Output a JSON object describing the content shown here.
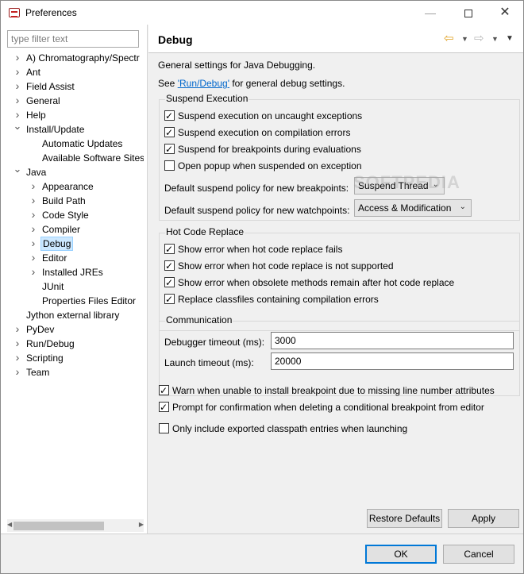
{
  "window": {
    "title": "Preferences",
    "minimize_glyph": "—",
    "close_glyph": "✕"
  },
  "filter": {
    "placeholder": "type filter text"
  },
  "tree": [
    {
      "label": "A) Chromatography/Spectr",
      "level": 0,
      "expanded": false,
      "has_children": true
    },
    {
      "label": "Ant",
      "level": 0,
      "expanded": false,
      "has_children": true
    },
    {
      "label": "Field Assist",
      "level": 0,
      "expanded": false,
      "has_children": true
    },
    {
      "label": "General",
      "level": 0,
      "expanded": false,
      "has_children": true
    },
    {
      "label": "Help",
      "level": 0,
      "expanded": false,
      "has_children": true
    },
    {
      "label": "Install/Update",
      "level": 0,
      "expanded": true,
      "has_children": true
    },
    {
      "label": "Automatic Updates",
      "level": 1,
      "expanded": false,
      "has_children": false
    },
    {
      "label": "Available Software Sites",
      "level": 1,
      "expanded": false,
      "has_children": false
    },
    {
      "label": "Java",
      "level": 0,
      "expanded": true,
      "has_children": true
    },
    {
      "label": "Appearance",
      "level": 1,
      "expanded": false,
      "has_children": true
    },
    {
      "label": "Build Path",
      "level": 1,
      "expanded": false,
      "has_children": true
    },
    {
      "label": "Code Style",
      "level": 1,
      "expanded": false,
      "has_children": true
    },
    {
      "label": "Compiler",
      "level": 1,
      "expanded": false,
      "has_children": true
    },
    {
      "label": "Debug",
      "level": 1,
      "expanded": false,
      "has_children": true,
      "selected": true
    },
    {
      "label": "Editor",
      "level": 1,
      "expanded": false,
      "has_children": true
    },
    {
      "label": "Installed JREs",
      "level": 1,
      "expanded": false,
      "has_children": true
    },
    {
      "label": "JUnit",
      "level": 1,
      "expanded": false,
      "has_children": false
    },
    {
      "label": "Properties Files Editor",
      "level": 1,
      "expanded": false,
      "has_children": false
    },
    {
      "label": "Jython external library",
      "level": 0,
      "expanded": false,
      "has_children": false
    },
    {
      "label": "PyDev",
      "level": 0,
      "expanded": false,
      "has_children": true
    },
    {
      "label": "Run/Debug",
      "level": 0,
      "expanded": false,
      "has_children": true
    },
    {
      "label": "Scripting",
      "level": 0,
      "expanded": false,
      "has_children": true
    },
    {
      "label": "Team",
      "level": 0,
      "expanded": false,
      "has_children": true
    }
  ],
  "page": {
    "title": "Debug",
    "description": "General settings for Java Debugging.",
    "see_prefix": "See ",
    "see_link": "'Run/Debug'",
    "see_suffix": " for general debug settings."
  },
  "suspend": {
    "title": "Suspend Execution",
    "options": [
      {
        "label": "Suspend execution on uncaught exceptions",
        "checked": true
      },
      {
        "label": "Suspend execution on compilation errors",
        "checked": true
      },
      {
        "label": "Suspend for breakpoints during evaluations",
        "checked": true
      },
      {
        "label": "Open popup when suspended on exception",
        "checked": false
      }
    ],
    "bp_policy_label": "Default suspend policy for new breakpoints:",
    "bp_policy_value": "Suspend Thread",
    "wp_policy_label": "Default suspend policy for new watchpoints:",
    "wp_policy_value": "Access & Modification"
  },
  "hcr": {
    "title": "Hot Code Replace",
    "options": [
      {
        "label": "Show error when hot code replace fails",
        "checked": true
      },
      {
        "label": "Show error when hot code replace is not supported",
        "checked": true
      },
      {
        "label": "Show error when obsolete methods remain after hot code replace",
        "checked": true
      },
      {
        "label": "Replace classfiles containing compilation errors",
        "checked": true
      }
    ]
  },
  "comm": {
    "title": "Communication",
    "debugger_timeout_label": "Debugger timeout (ms):",
    "debugger_timeout_value": "3000",
    "launch_timeout_label": "Launch timeout (ms):",
    "launch_timeout_value": "20000"
  },
  "misc": [
    {
      "label": "Warn when unable to install breakpoint due to missing line number attributes",
      "checked": true
    },
    {
      "label": "Prompt for confirmation when deleting a conditional breakpoint from editor",
      "checked": true
    },
    {
      "label": "Only include exported classpath entries when launching",
      "checked": false
    }
  ],
  "buttons": {
    "restore_defaults": "Restore Defaults",
    "apply": "Apply",
    "ok": "OK",
    "cancel": "Cancel"
  },
  "watermark": "SOFTPEDIA"
}
